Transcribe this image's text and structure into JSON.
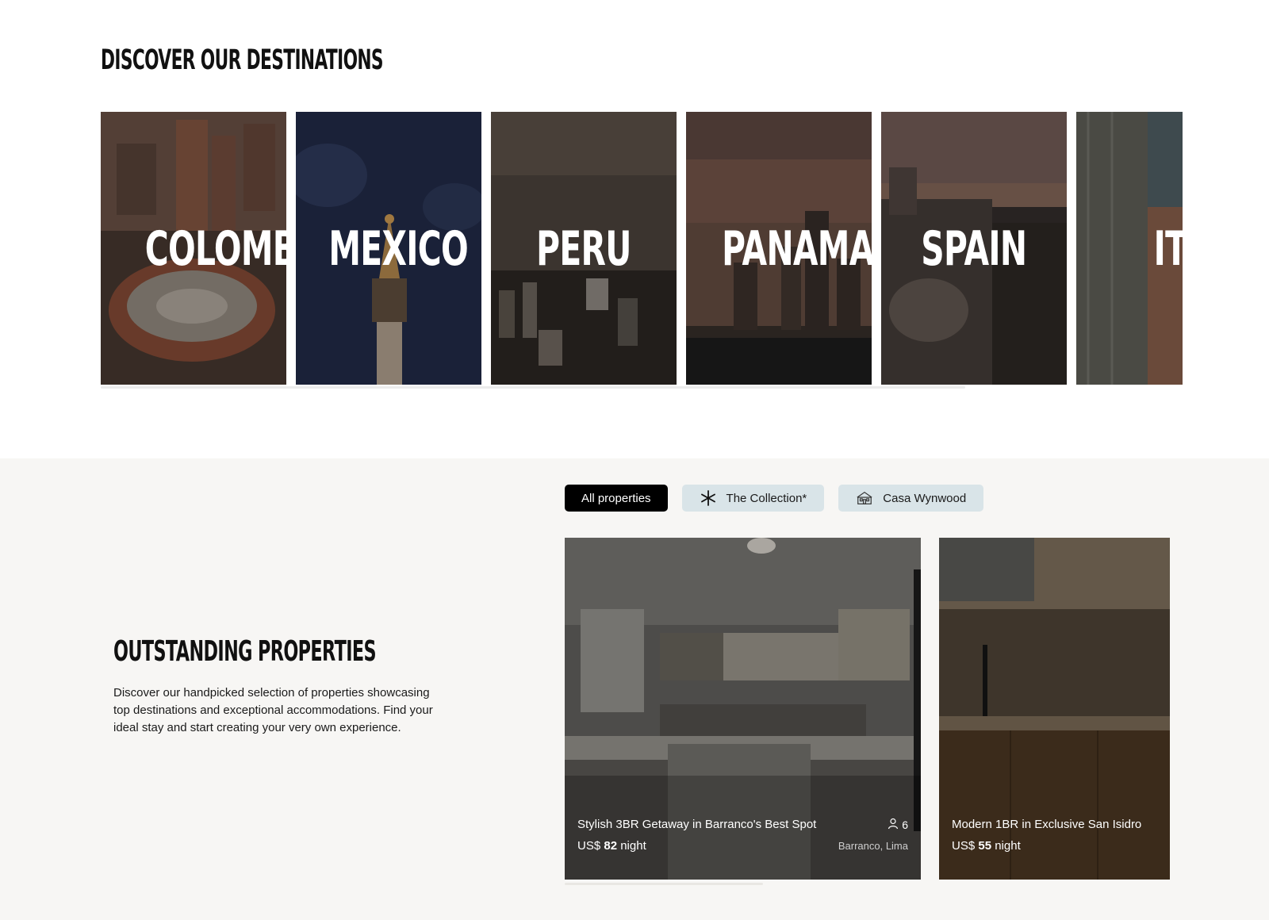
{
  "destinations": {
    "title": "DISCOVER OUR DESTINATIONS",
    "items": [
      {
        "label": "COLOMBIA"
      },
      {
        "label": "MEXICO"
      },
      {
        "label": "PERU"
      },
      {
        "label": "PANAMA"
      },
      {
        "label": "SPAIN"
      },
      {
        "label": "ITALY"
      }
    ]
  },
  "properties": {
    "title": "OUTSTANDING PROPERTIES",
    "description": "Discover our handpicked selection of properties showcasing top destinations and exceptional accommodations. Find your ideal stay and start creating your very own experience.",
    "filters": [
      {
        "label": "All properties",
        "active": true
      },
      {
        "label": "The Collection*",
        "icon": "asterisk-icon"
      },
      {
        "label": "Casa Wynwood",
        "icon": "house-icon"
      }
    ],
    "cards": [
      {
        "name": "Stylish 3BR Getaway in Barranco's Best Spot",
        "currency": "US$",
        "price": "82",
        "unit": "night",
        "guests": "6",
        "location": "Barranco, Lima"
      },
      {
        "name": "Modern 1BR in Exclusive San Isidro",
        "currency": "US$",
        "price": "55",
        "unit": "night"
      }
    ]
  },
  "colors": {
    "accent": "#000000",
    "chip_bg": "#d9e4e8",
    "section_bg": "#f7f6f4"
  }
}
